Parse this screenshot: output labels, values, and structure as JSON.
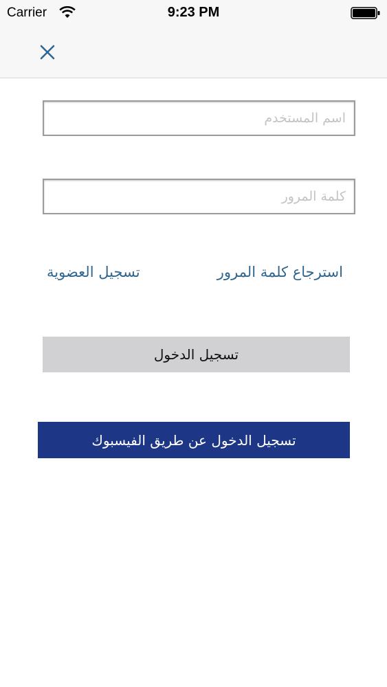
{
  "status_bar": {
    "carrier": "Carrier",
    "time": "9:23 PM",
    "wifi_icon": "wifi-icon",
    "battery_icon": "battery-icon"
  },
  "nav_bar": {
    "close_icon": "close-icon",
    "close_color": "#2f6690"
  },
  "form": {
    "username_placeholder": "اسم المستخدم",
    "username_value": "",
    "password_placeholder": "كلمة المرور",
    "password_value": ""
  },
  "links": {
    "forgot_password": "استرجاع كلمة المرور",
    "register": "تسجيل العضوية",
    "color": "#2f6690"
  },
  "buttons": {
    "login": "تسجيل الدخول",
    "login_color": "#d1d1d4",
    "facebook_login": "تسجيل الدخول عن طريق الفيسبوك",
    "facebook_color": "#1d3786"
  }
}
